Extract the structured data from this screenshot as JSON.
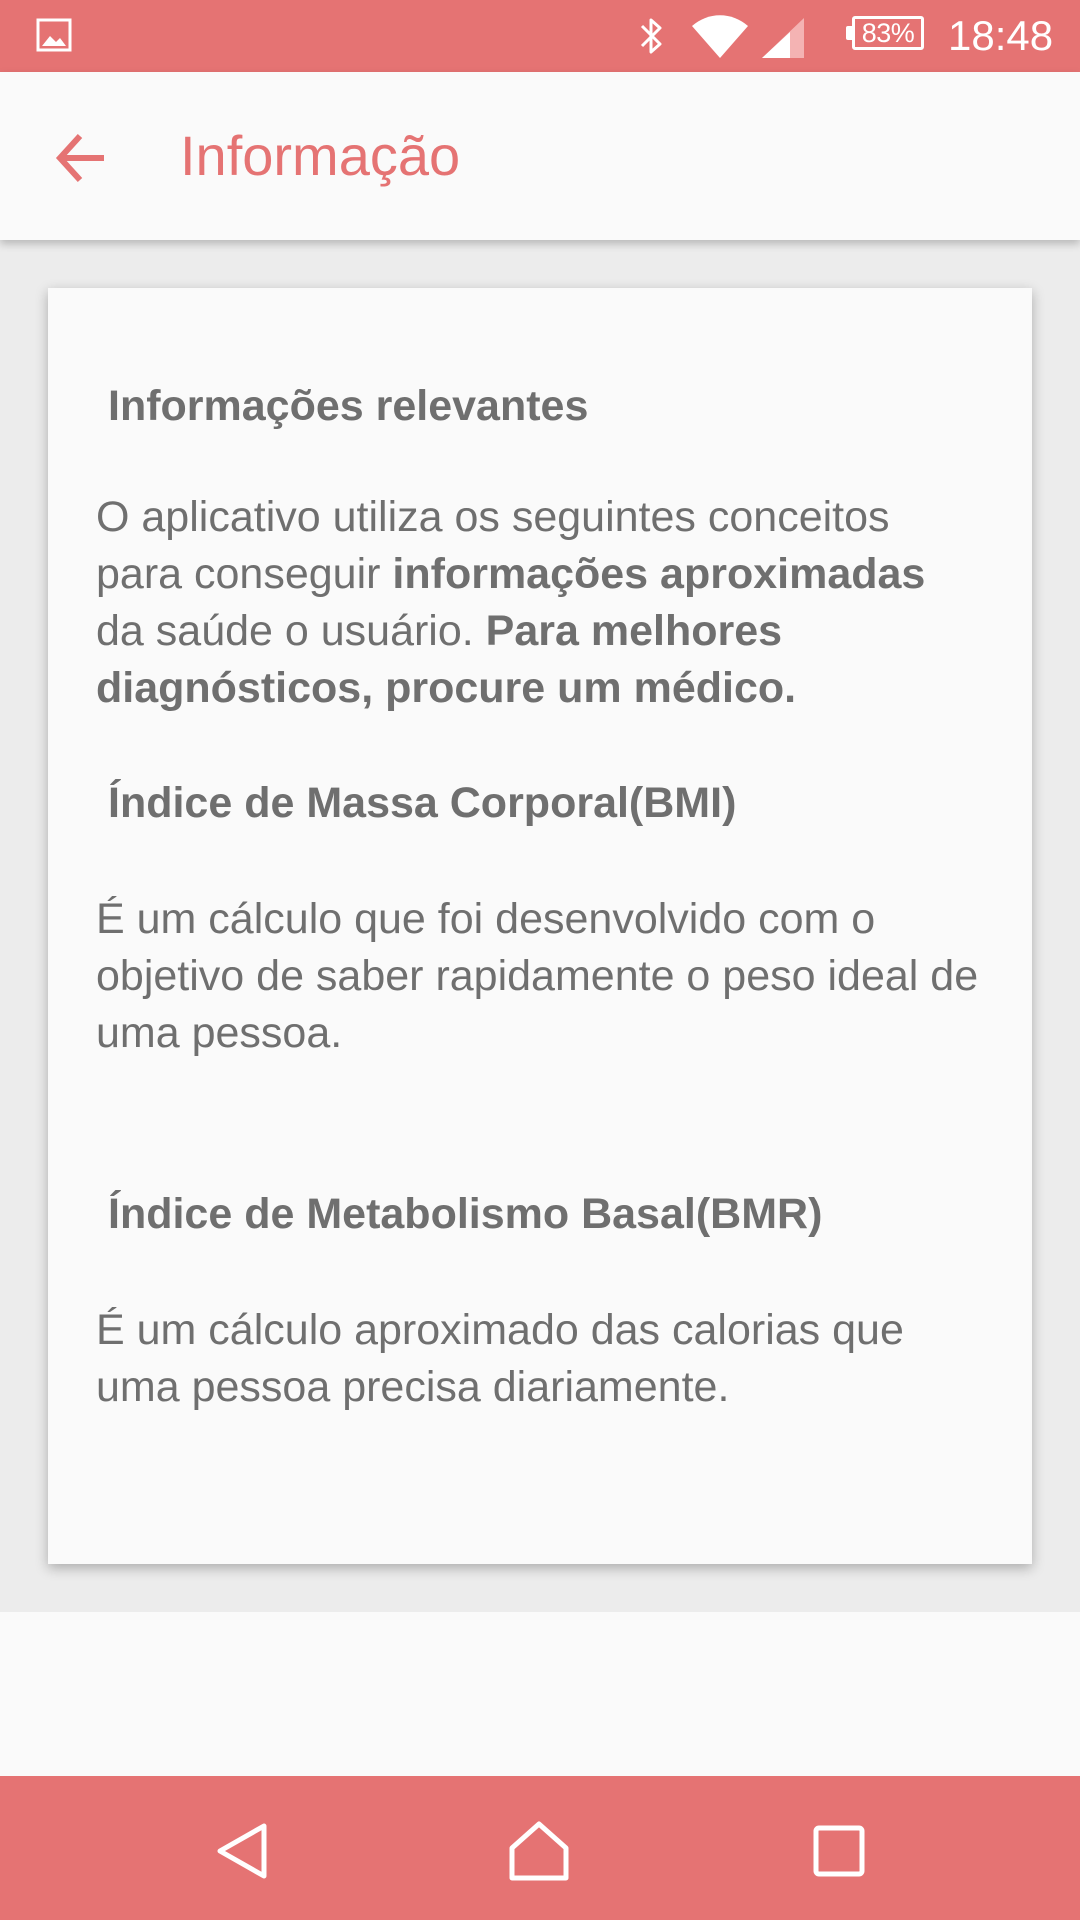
{
  "status_bar": {
    "battery_level": "83%",
    "time": "18:48",
    "icons": [
      "gallery-icon",
      "bluetooth-icon",
      "wifi-icon",
      "signal-icon",
      "battery-icon"
    ]
  },
  "app_bar": {
    "back_icon": "arrow-left-icon",
    "title": "Informação"
  },
  "card": {
    "section1_heading": "Informações relevantes",
    "section1_text": {
      "part1": " O aplicativo utiliza os seguintes conceitos para conseguir ",
      "bold1": "informações aproximadas",
      "part2": " da saúde o usuário. ",
      "bold2": "Para melhores diagnósticos, procure um médico."
    },
    "section2_heading": "Índice de Massa Corporal(BMI)",
    "section2_text": " É um cálculo que foi desenvolvido com o objetivo de saber rapidamente o peso ideal de uma pessoa.",
    "section3_heading": "Índice de Metabolismo Basal(BMR)",
    "section3_text": " É um cálculo aproximado das calorias que uma pessoa precisa diariamente."
  },
  "nav_bar": {
    "icons": [
      "back-triangle-icon",
      "home-icon",
      "recents-icon"
    ]
  },
  "colors": {
    "accent": "#e57373",
    "text": "#6f6f6f",
    "background": "#fafafa",
    "content_background": "#ececec"
  }
}
